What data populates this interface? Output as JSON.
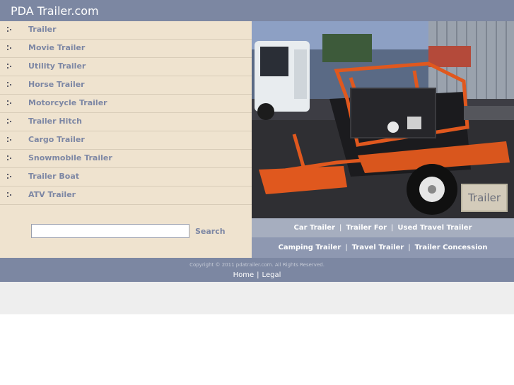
{
  "header": {
    "title": "PDA Trailer.com"
  },
  "sidebar": {
    "items": [
      {
        "label": "Trailer"
      },
      {
        "label": "Movie Trailer"
      },
      {
        "label": "Utility Trailer"
      },
      {
        "label": "Horse Trailer"
      },
      {
        "label": "Motorcycle Trailer"
      },
      {
        "label": "Trailer Hitch"
      },
      {
        "label": "Cargo Trailer"
      },
      {
        "label": "Snowmobile Trailer"
      },
      {
        "label": "Trailer Boat"
      },
      {
        "label": "ATV Trailer"
      }
    ],
    "search": {
      "value": "",
      "button_label": "Search"
    }
  },
  "photo": {
    "badge": "Trailer"
  },
  "links_row_1": [
    "Car Trailer",
    "Trailer For",
    "Used Travel Trailer"
  ],
  "links_row_2": [
    "Camping Trailer",
    "Travel Trailer",
    "Trailer Concession"
  ],
  "link_separator": "|",
  "footer": {
    "copyright": "Copyright © 2011 pdatrailer.com. All Rights Reserved.",
    "home": "Home",
    "separator": "|",
    "legal": "Legal"
  },
  "colors": {
    "header_bg": "#7c87a2",
    "sidebar_bg": "#efe3cf",
    "nav_text": "#7d87a4",
    "links_bar_light": "#a6aebf",
    "links_bar_dark": "#8e98b1"
  }
}
